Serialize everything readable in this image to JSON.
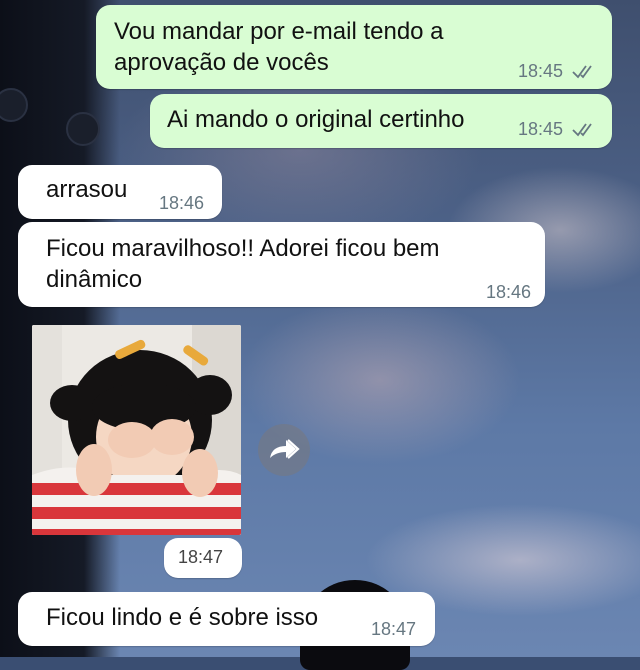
{
  "messages": [
    {
      "id": "m1",
      "direction": "outgoing",
      "text": "Vou mandar por e-mail tendo a\naprovação de vocês",
      "time": "18:45",
      "status_icon": "double-check-icon"
    },
    {
      "id": "m2",
      "direction": "outgoing",
      "text": "Ai mando o original certinho",
      "time": "18:45",
      "status_icon": "double-check-icon"
    },
    {
      "id": "m3",
      "direction": "incoming",
      "text": "arrasou",
      "time": "18:46"
    },
    {
      "id": "m4",
      "direction": "incoming",
      "text": "Ficou maravilhoso!! Adorei ficou bem\ndinâmico",
      "time": "18:46"
    },
    {
      "id": "m5",
      "direction": "incoming",
      "type": "image",
      "time": "18:47",
      "action_icon": "forward-icon"
    },
    {
      "id": "m6",
      "direction": "incoming",
      "text": "Ficou lindo e é sobre isso",
      "time": "18:47"
    }
  ],
  "colors": {
    "outgoing_bubble": "#d9fdd3",
    "incoming_bubble": "#ffffff",
    "meta_text": "#667781",
    "check_color": "#667781"
  }
}
